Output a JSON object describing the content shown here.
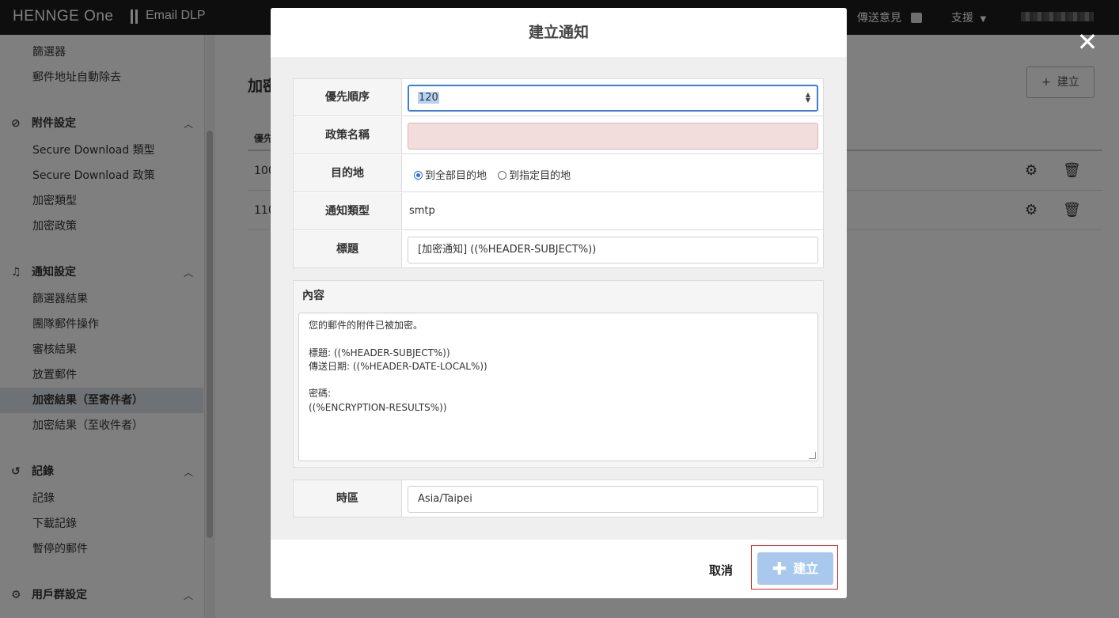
{
  "topbar": {
    "brand": "HENNGE One",
    "product": "Email DLP",
    "feedback": "傳送意見",
    "support": "支援"
  },
  "sidebar": {
    "items_top": [
      "篩選器",
      "郵件地址自動除去"
    ],
    "attachment_section": "附件設定",
    "attachment_items": [
      "Secure Download 類型",
      "Secure Download 政策",
      "加密類型",
      "加密政策"
    ],
    "notify_section": "通知設定",
    "notify_items": [
      "篩選器結果",
      "團隊郵件操作",
      "審核結果",
      "放置郵件",
      "加密結果（至寄件者）",
      "加密結果（至收件者）"
    ],
    "log_section": "記錄",
    "log_items": [
      "記錄",
      "下載記錄",
      "暫停的郵件"
    ],
    "usergroup_section": "用戶群設定"
  },
  "main": {
    "title": "加密",
    "create_button": "建立",
    "col_priority": "優先",
    "rows": [
      "100",
      "110"
    ]
  },
  "modal": {
    "title": "建立通知",
    "fields": {
      "priority_label": "優先順序",
      "priority_value": "120",
      "policy_name_label": "政策名稱",
      "policy_name_value": "",
      "destination_label": "目的地",
      "destination_all": "到全部目的地",
      "destination_specific": "到指定目的地",
      "notify_type_label": "通知類型",
      "notify_type_value": "smtp",
      "subject_label": "標題",
      "subject_value": "[加密通知] ((%HEADER-SUBJECT%))",
      "content_label": "內容",
      "content_value": "您的郵件的附件已被加密。\n\n標題: ((%HEADER-SUBJECT%))\n傳送日期: ((%HEADER-DATE-LOCAL%))\n\n密碼:\n((%ENCRYPTION-RESULTS%))",
      "timezone_label": "時區",
      "timezone_value": "Asia/Taipei"
    },
    "cancel": "取消",
    "submit": "建立"
  }
}
